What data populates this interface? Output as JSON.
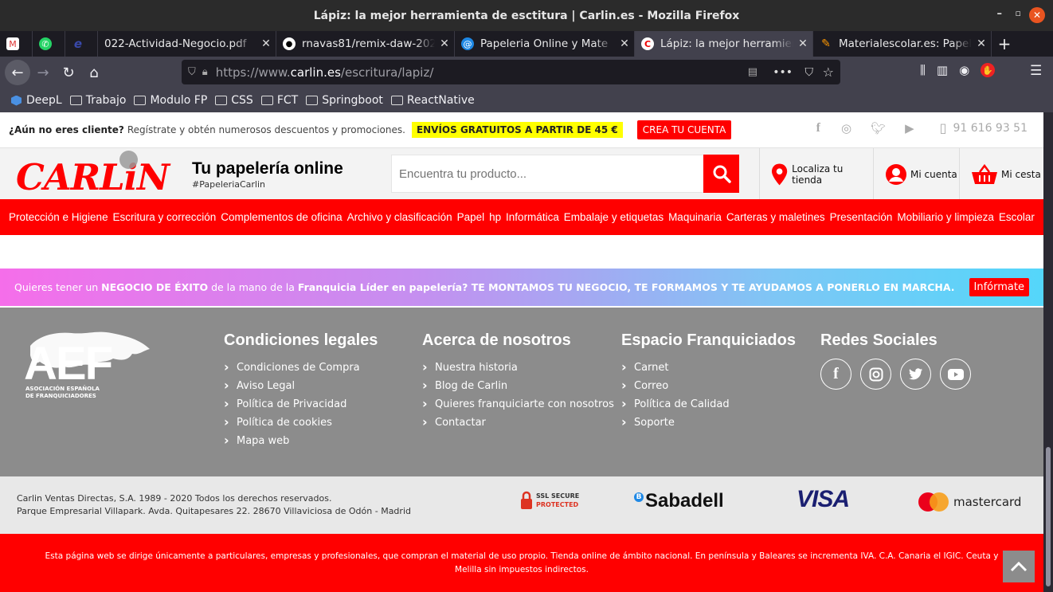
{
  "window": {
    "title": "Lápiz: la mejor herramienta de esctitura | Carlin.es - Mozilla Firefox"
  },
  "tabs": [
    {
      "label": "",
      "icon": "gmail-icon"
    },
    {
      "label": "",
      "icon": "whatsapp-icon"
    },
    {
      "label": "",
      "icon": "e-icon"
    },
    {
      "label": "022-Actividad-Negocio.pdf",
      "icon": "pdf-icon"
    },
    {
      "label": "rnavas81/remix-daw-202",
      "icon": "github-icon"
    },
    {
      "label": "Papeleria Online y Mate",
      "icon": "at-icon"
    },
    {
      "label": "Lápiz: la mejor herramien",
      "icon": "carlin-icon",
      "active": true
    },
    {
      "label": "Materialescolar.es: Papel",
      "icon": "materialescolar-icon"
    }
  ],
  "nav": {
    "url_prefix": "https://www.",
    "url_domain": "carlin.es",
    "url_path": "/escritura/lapiz/"
  },
  "bookmarks": [
    "DeepL",
    "Trabajo",
    "Modulo FP",
    "CSS",
    "FCT",
    "Springboot",
    "ReactNative"
  ],
  "topstrip": {
    "text_bold": "¿Aún no eres cliente?",
    "text": "Regístrate y obtén numerosos descuentos y promociones.",
    "promo": "ENVÍOS GRATUITOS A PARTIR DE 45 €",
    "create_account": "CREA TU CUENTA",
    "phone": "91 616 93 51"
  },
  "header": {
    "logo": "CARLiN",
    "tagline": "Tu papelería online",
    "hashtag": "#PapeleriaCarlin",
    "search_placeholder": "Encuentra tu producto...",
    "store": "Localiza tu tienda",
    "account": "Mi cuenta",
    "cart": "Mi cesta"
  },
  "categories": [
    "Protección e Higiene",
    "Escritura y corrección",
    "Complementos de oficina",
    "Archivo y clasificación",
    "Papel",
    "hp",
    "Informática",
    "Embalaje y etiquetas",
    "Maquinaria",
    "Carteras y maletines",
    "Presentación",
    "Mobiliario y limpieza",
    "Escolar"
  ],
  "franquicia": {
    "t1": "Quieres tener un ",
    "b1": "NEGOCIO DE ÉXITO",
    "t2": " de la mano de la ",
    "b2": "Franquicia Líder en papelería? TE MONTAMOS TU NEGOCIO, TE FORMAMOS Y TE AYUDAMOS A PONERLO EN MARCHA.",
    "button": "Infórmate"
  },
  "footer": {
    "aef_logo": "AEF",
    "aef_sub1": "ASOCIACIÓN ESPAÑOLA",
    "aef_sub2": "DE FRANQUICIADORES",
    "col1": {
      "title": "Condiciones legales",
      "items": [
        "Condiciones de Compra",
        "Aviso Legal",
        "Política de Privacidad",
        "Política de cookies",
        "Mapa web"
      ]
    },
    "col2": {
      "title": "Acerca de nosotros",
      "items": [
        "Nuestra historia",
        "Blog de Carlin",
        "Quieres franquiciarte con nosotros",
        "Contactar"
      ]
    },
    "col3": {
      "title": "Espacio Franquiciados",
      "items": [
        "Carnet",
        "Correo",
        "Política de Calidad",
        "Soporte"
      ]
    },
    "col4": {
      "title": "Redes Sociales"
    }
  },
  "legal": {
    "line1": "Carlin Ventas Directas, S.A. 1989 - 2020 Todos los derechos reservados.",
    "line2": "Parque Empresarial Villapark. Avda. Quitapesares 22. 28670 Villaviciosa de Odón - Madrid",
    "ssl1": "SSL SECURE",
    "ssl2": "PROTECTED",
    "sabadell": "Sabadell",
    "visa": "VISA",
    "mastercard": "mastercard"
  },
  "disclaimer": "Esta página web se dirige únicamente a particulares, empresas y profesionales, que compran el material de uso propio. Tienda online de ámbito nacional. En península y Baleares se incrementa IVA. C.A. Canaria el IGIC. Ceuta y Melilla sin impuestos indirectos.",
  "colors": {
    "brand_red": "#ff0000",
    "footer_gray": "#8c8c8c",
    "promo_yellow": "#ffff00"
  }
}
